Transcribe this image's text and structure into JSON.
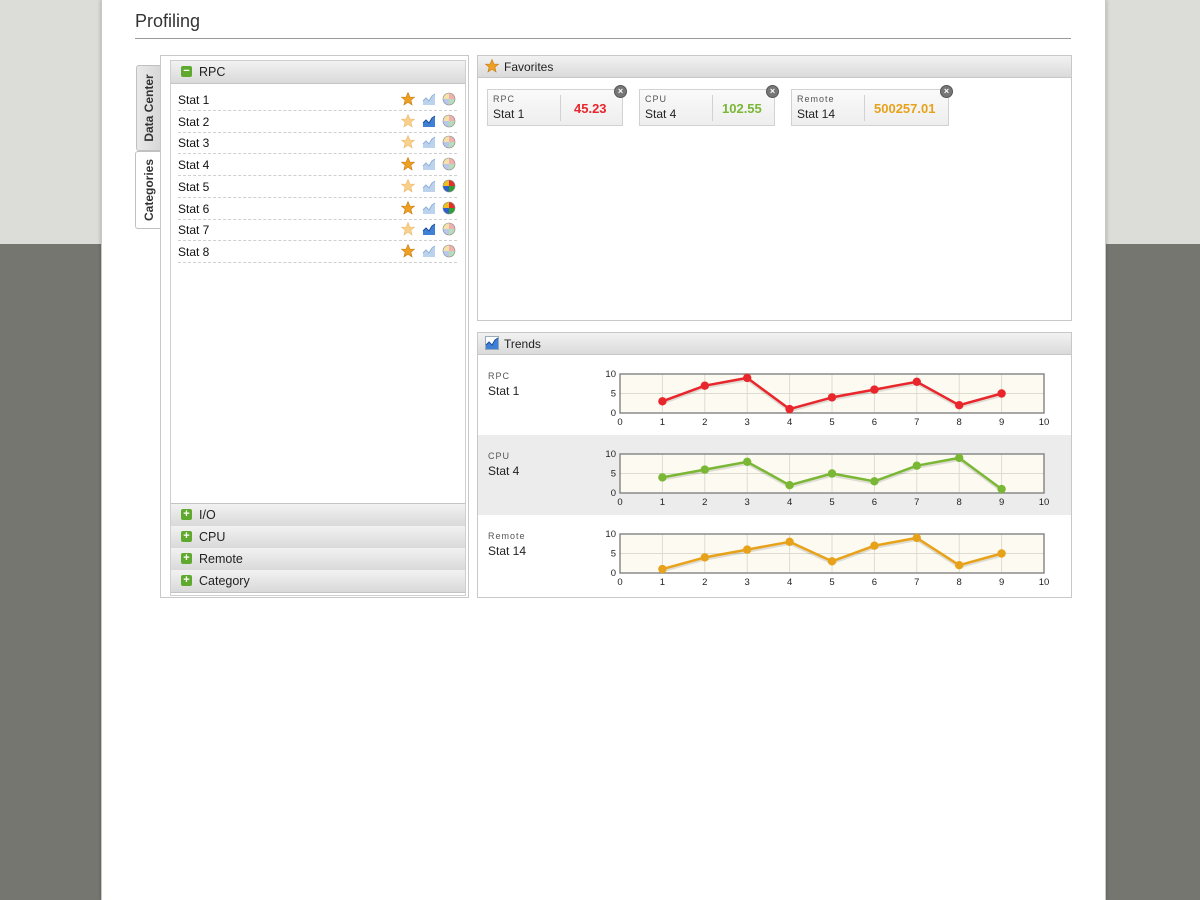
{
  "page": {
    "title": "Profiling"
  },
  "tabs": [
    {
      "label": "Data Center",
      "active": false
    },
    {
      "label": "Categories",
      "active": true
    }
  ],
  "categories": {
    "expanded": {
      "label": "RPC",
      "toggle": "−",
      "stats": [
        {
          "name": "Stat 1",
          "favorite": true,
          "trend": false,
          "pie": false
        },
        {
          "name": "Stat 2",
          "favorite": false,
          "trend": true,
          "pie": false
        },
        {
          "name": "Stat 3",
          "favorite": false,
          "trend": false,
          "pie": false
        },
        {
          "name": "Stat 4",
          "favorite": true,
          "trend": false,
          "pie": false
        },
        {
          "name": "Stat 5",
          "favorite": false,
          "trend": false,
          "pie": true
        },
        {
          "name": "Stat 6",
          "favorite": true,
          "trend": false,
          "pie": true
        },
        {
          "name": "Stat 7",
          "favorite": false,
          "trend": true,
          "pie": false
        },
        {
          "name": "Stat 8",
          "favorite": true,
          "trend": false,
          "pie": false
        }
      ]
    },
    "collapsed": [
      {
        "label": "I/O",
        "toggle": "+"
      },
      {
        "label": "CPU",
        "toggle": "+"
      },
      {
        "label": "Remote",
        "toggle": "+"
      },
      {
        "label": "Category",
        "toggle": "+"
      }
    ]
  },
  "favorites": {
    "title": "Favorites",
    "items": [
      {
        "category": "RPC",
        "stat": "Stat 1",
        "value": "45.23",
        "color": "#e8262c"
      },
      {
        "category": "CPU",
        "stat": "Stat 4",
        "value": "102.55",
        "color": "#7ab735"
      },
      {
        "category": "Remote",
        "stat": "Stat 14",
        "value": "500257.01",
        "color": "#e8a21a"
      }
    ]
  },
  "trends": {
    "title": "Trends",
    "chart_data": [
      {
        "type": "line",
        "category": "RPC",
        "stat": "Stat 1",
        "color": "#e8262c",
        "x": [
          1,
          2,
          3,
          4,
          5,
          6,
          7,
          8,
          9
        ],
        "values": [
          3,
          7,
          9,
          1,
          4,
          6,
          8,
          2,
          5
        ],
        "xlim": [
          0,
          10
        ],
        "ylim": [
          0,
          10
        ],
        "xticks": [
          "0",
          "1",
          "2",
          "3",
          "4",
          "5",
          "6",
          "7",
          "8",
          "9",
          "10"
        ],
        "yticks": [
          "0",
          "5",
          "10"
        ],
        "grid": true
      },
      {
        "type": "line",
        "category": "CPU",
        "stat": "Stat 4",
        "color": "#7ab735",
        "x": [
          1,
          2,
          3,
          4,
          5,
          6,
          7,
          8,
          9
        ],
        "values": [
          4,
          6,
          8,
          2,
          5,
          3,
          7,
          9,
          1
        ],
        "xlim": [
          0,
          10
        ],
        "ylim": [
          0,
          10
        ],
        "xticks": [
          "0",
          "1",
          "2",
          "3",
          "4",
          "5",
          "6",
          "7",
          "8",
          "9",
          "10"
        ],
        "yticks": [
          "0",
          "5",
          "10"
        ],
        "grid": true
      },
      {
        "type": "line",
        "category": "Remote",
        "stat": "Stat 14",
        "color": "#e8a21a",
        "x": [
          1,
          2,
          3,
          4,
          5,
          6,
          7,
          8,
          9
        ],
        "values": [
          1,
          4,
          6,
          8,
          3,
          7,
          9,
          2,
          5
        ],
        "xlim": [
          0,
          10
        ],
        "ylim": [
          0,
          10
        ],
        "xticks": [
          "0",
          "1",
          "2",
          "3",
          "4",
          "5",
          "6",
          "7",
          "8",
          "9",
          "10"
        ],
        "yticks": [
          "0",
          "5",
          "10"
        ],
        "grid": true
      }
    ]
  },
  "colors": {
    "star": "#f0a020",
    "star_faded": "#f8d08a",
    "toggle": "#5faa2e"
  }
}
